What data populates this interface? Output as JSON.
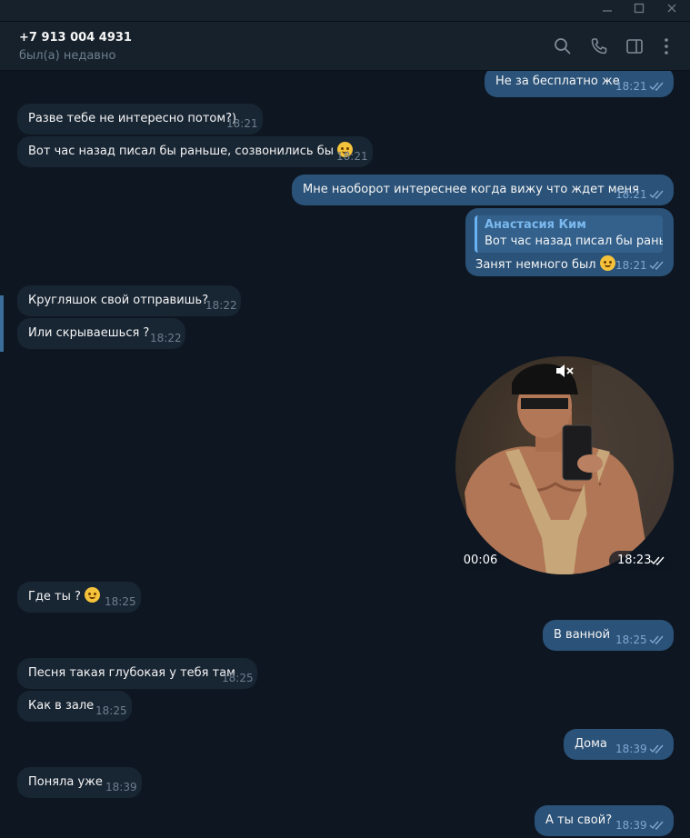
{
  "peer": {
    "name": "+7 913 004 4931",
    "status": "был(а) недавно"
  },
  "header_icons": [
    "search-icon",
    "phone-icon",
    "sidebar-toggle-icon",
    "more-vertical-icon"
  ],
  "window_controls": [
    "minimize-icon",
    "maximize-icon",
    "close-icon"
  ],
  "colors": {
    "background": "#0e1621",
    "incoming_bubble": "#182533",
    "outgoing_bubble": "#2b5278",
    "accent": "#6ab3f3"
  },
  "messages": [
    {
      "dir": "out",
      "text": "Не за бесплатно же",
      "time": "18:21"
    },
    {
      "dir": "in",
      "text": "Разве тебе не интересно потом?)",
      "time": "18:21"
    },
    {
      "dir": "in",
      "text": "Вот час назад писал бы раньше, созвонились бы",
      "emoji": "smiling-face-emoji",
      "time": "18:21"
    },
    {
      "dir": "out",
      "text": "Мне наоборот интереснее когда вижу что ждет меня",
      "time": "18:21"
    },
    {
      "dir": "out",
      "reply_to": {
        "author": "Анастасия Ким",
        "text": "Вот час назад писал бы рань..."
      },
      "text": "Занят немного был",
      "emoji": "grinning-sweat-emoji",
      "time": "18:21"
    },
    {
      "dir": "in",
      "text": "Кругляшок свой отправишь?",
      "time": "18:22"
    },
    {
      "dir": "in",
      "text": "Или скрываешься ?",
      "time": "18:22"
    },
    {
      "dir": "out",
      "video_note": {
        "duration": "00:06",
        "muted": true
      },
      "time": "18:23"
    },
    {
      "dir": "in",
      "text": "Где ты ?",
      "emoji": "thinking-face-emoji",
      "time": "18:25"
    },
    {
      "dir": "out",
      "text": "В ванной",
      "time": "18:25"
    },
    {
      "dir": "in",
      "text": "Песня такая глубокая у тебя там",
      "time": "18:25"
    },
    {
      "dir": "in",
      "text": "Как в зале",
      "time": "18:25"
    },
    {
      "dir": "out",
      "text": "Дома",
      "time": "18:39"
    },
    {
      "dir": "in",
      "text": "Поняла уже",
      "time": "18:39"
    },
    {
      "dir": "out",
      "text": "А ты свой?",
      "time": "18:39"
    }
  ]
}
